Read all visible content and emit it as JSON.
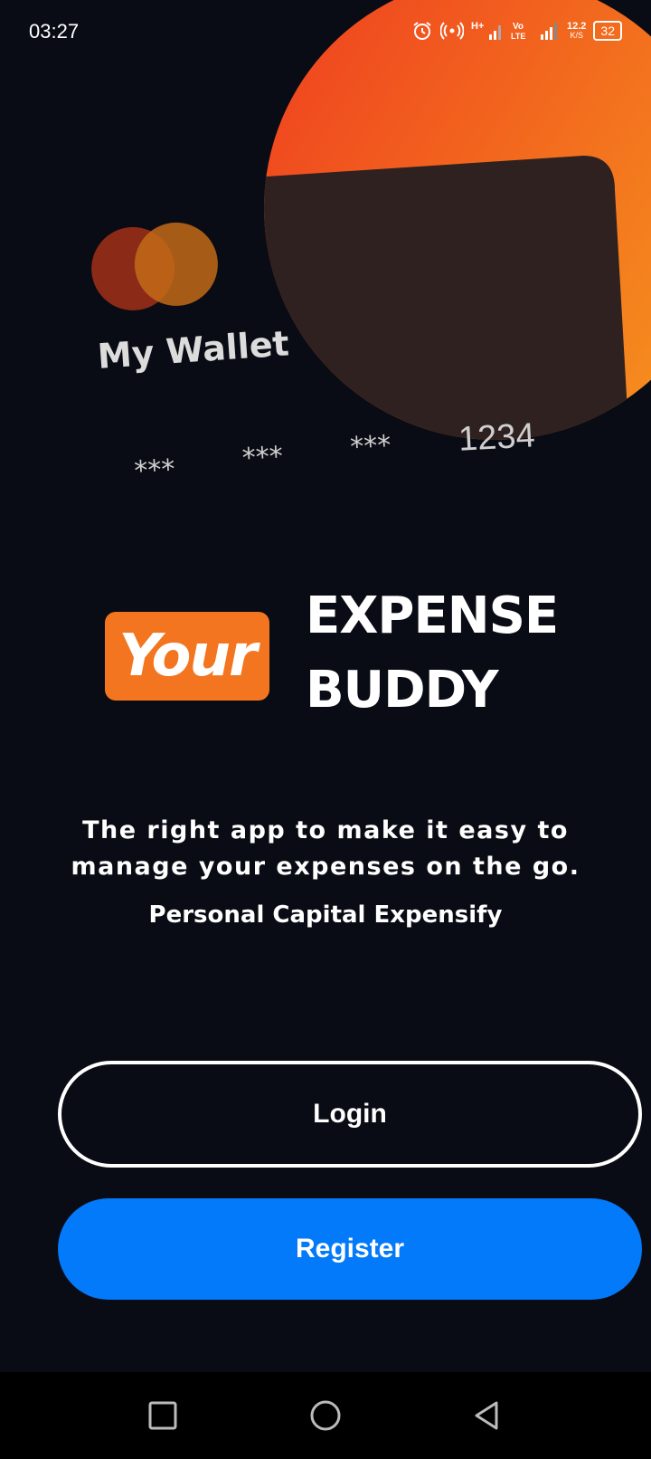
{
  "status_bar": {
    "time": "03:27",
    "icons": [
      "alarm-icon",
      "hotspot-icon",
      "signal-h-plus-icon",
      "volte-icon",
      "signal-icon"
    ],
    "net_speed_value": "12.2",
    "net_speed_unit": "K/S",
    "battery": "32"
  },
  "card": {
    "wallet_label": "My Wallet",
    "number_groups": [
      "***",
      "***",
      "***",
      "1234"
    ]
  },
  "brand": {
    "badge": "Your",
    "line1": "EXPENSE",
    "line2": "BUDDY"
  },
  "tagline": "The right app to make it easy to manage your expenses on the go.",
  "subtitle": "Personal Capital Expensify",
  "buttons": {
    "login": "Login",
    "register": "Register"
  },
  "colors": {
    "background": "#090c14",
    "accent_orange": "#f4751f",
    "register_blue": "#037af9"
  },
  "nav": {
    "icons": [
      "recents-square-icon",
      "home-circle-icon",
      "back-triangle-icon"
    ]
  }
}
